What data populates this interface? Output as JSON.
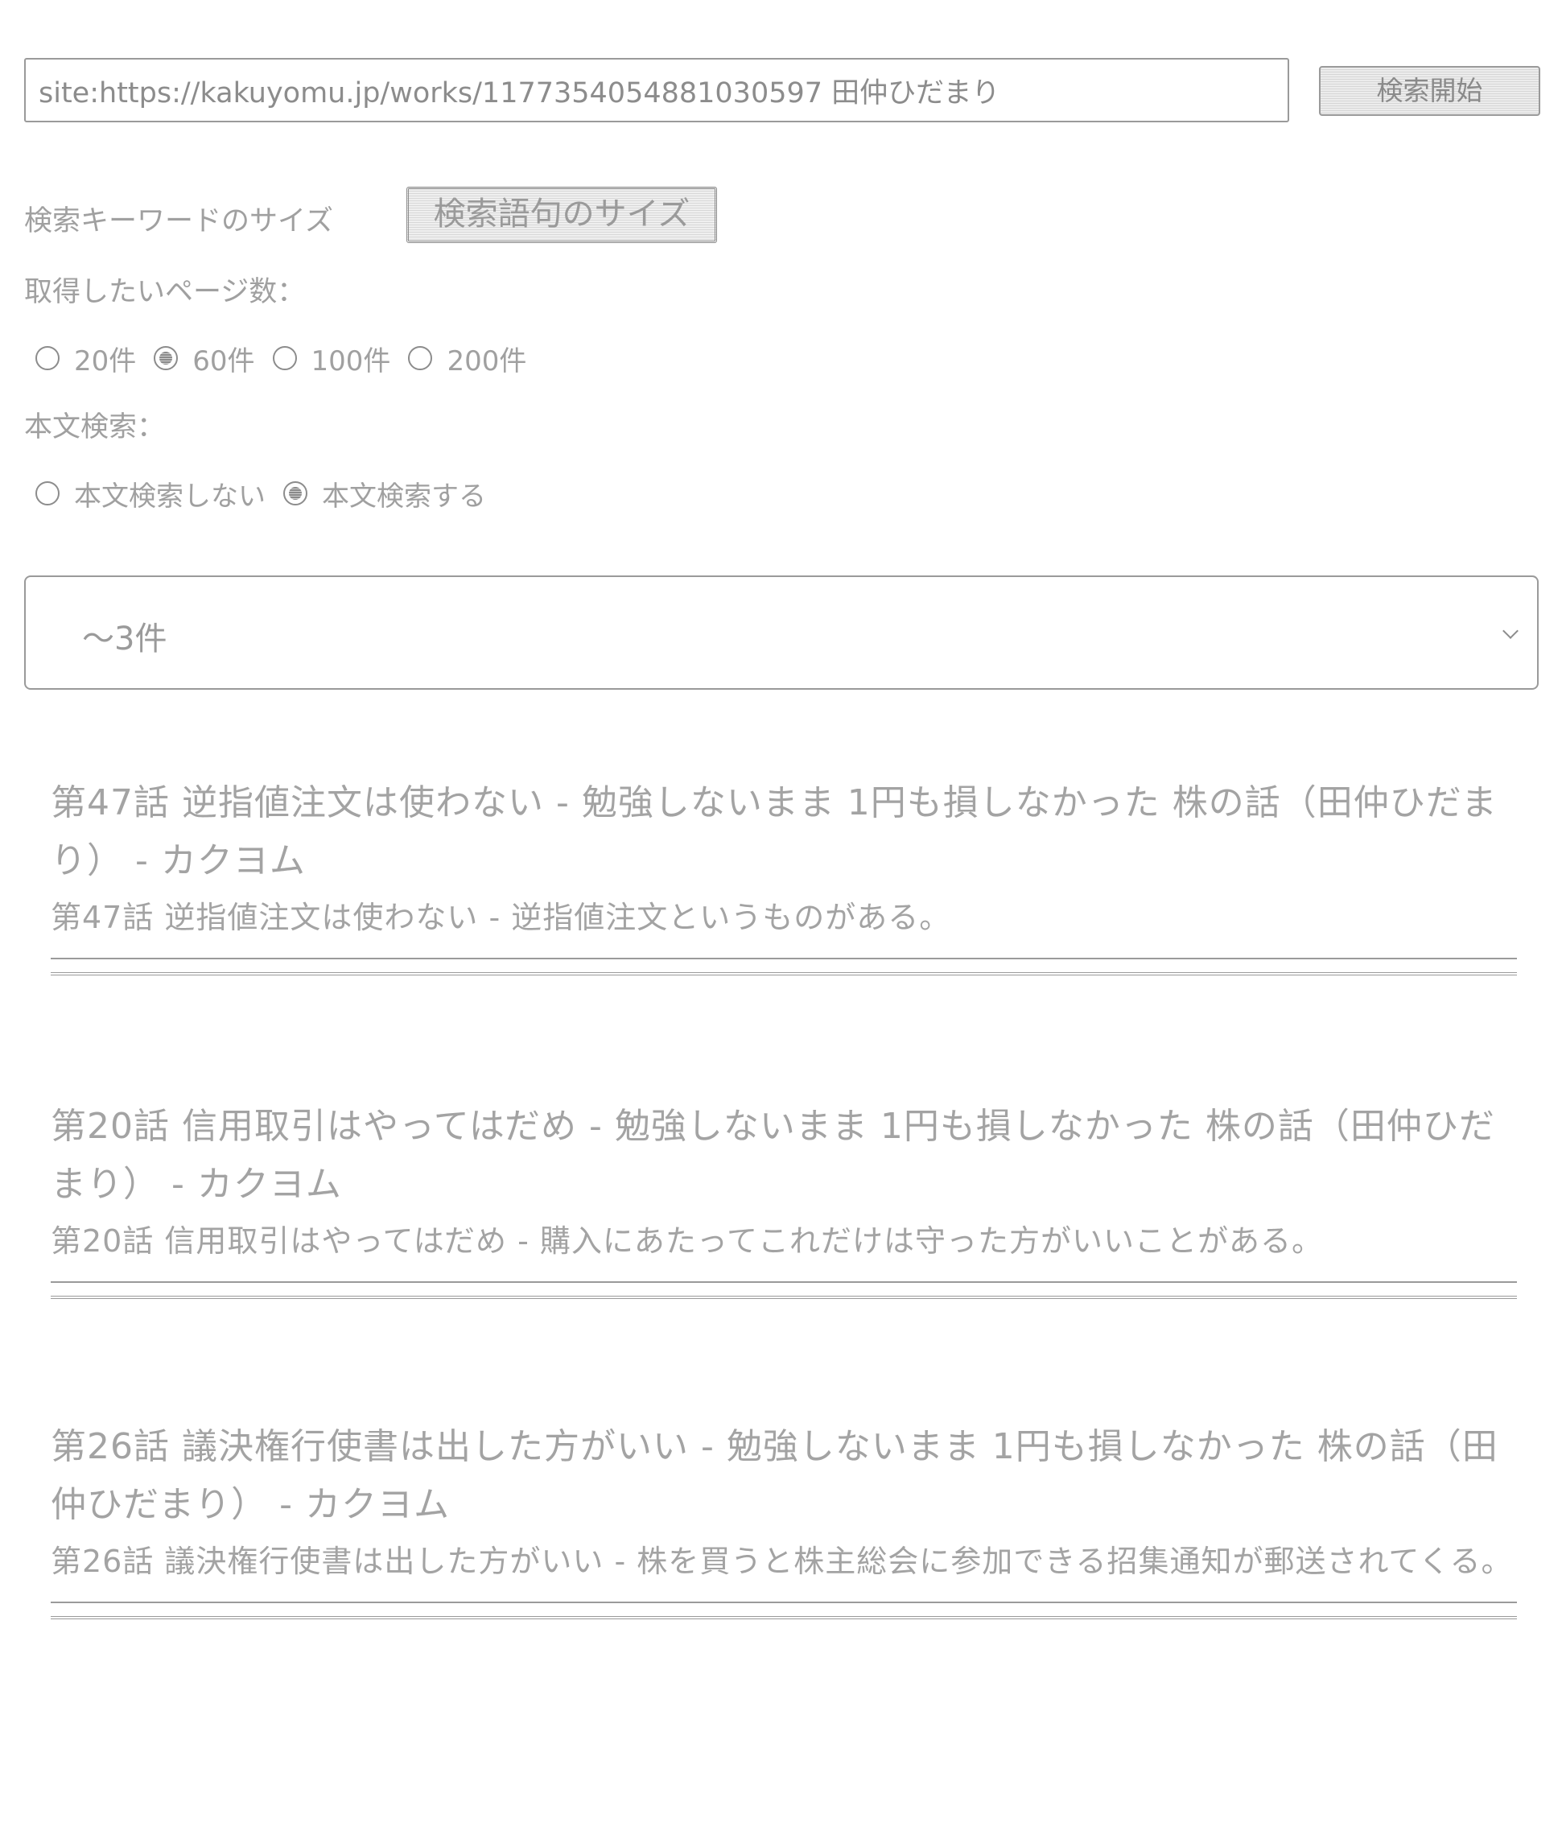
{
  "search": {
    "query": "site:https://kakuyomu.jp/works/1177354054881030597 田仲ひだまり",
    "button_label": "検索開始"
  },
  "keyword_size": {
    "label": "検索キーワードのサイズ",
    "button_label": "検索語句のサイズ"
  },
  "page_count": {
    "label": "取得したいページ数：",
    "options": [
      {
        "label": "20件",
        "checked": false
      },
      {
        "label": "60件",
        "checked": true
      },
      {
        "label": "100件",
        "checked": false
      },
      {
        "label": "200件",
        "checked": false
      }
    ]
  },
  "fulltext": {
    "label": "本文検索：",
    "options": [
      {
        "label": "本文検索しない",
        "checked": false
      },
      {
        "label": "本文検索する",
        "checked": true
      }
    ]
  },
  "result_filter": {
    "selected": "～3件"
  },
  "results": [
    {
      "title": "第47話 逆指値注文は使わない - 勉強しないまま 1円も損しなかった 株の話（田仲ひだまり） - カクヨム",
      "snippet": "第47話 逆指値注文は使わない - 逆指値注文というものがある。"
    },
    {
      "title": "第20話 信用取引はやってはだめ - 勉強しないまま 1円も損しなかった 株の話（田仲ひだまり） - カクヨム",
      "snippet": "第20話 信用取引はやってはだめ - 購入にあたってこれだけは守った方がいいことがある。"
    },
    {
      "title": "第26話 議決権行使書は出した方がいい - 勉強しないまま 1円も損しなかった 株の話（田仲ひだまり） - カクヨム",
      "snippet": "第26話 議決権行使書は出した方がいい - 株を買うと株主総会に参加できる招集通知が郵送されてくる。"
    }
  ]
}
